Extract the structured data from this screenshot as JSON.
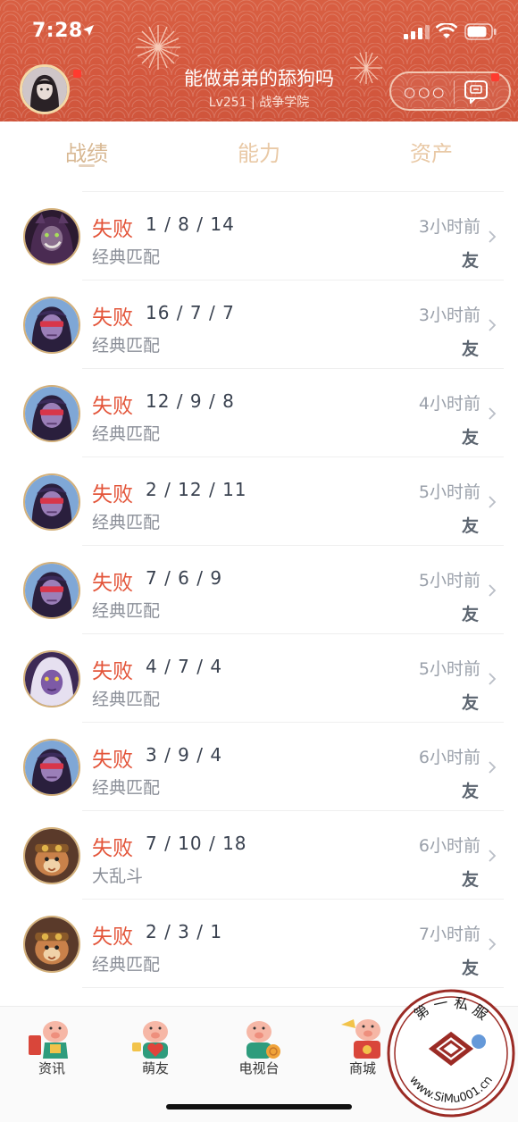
{
  "status_bar": {
    "time": "7:28"
  },
  "profile": {
    "name": "能做弟弟的舔狗吗",
    "subtitle": "Lv251 | 战争学院",
    "more_label": "○○○"
  },
  "tabs": [
    {
      "label": "战绩",
      "active": true
    },
    {
      "label": "能力",
      "active": false
    },
    {
      "label": "资产",
      "active": false
    }
  ],
  "matches": [
    {
      "result": "失败",
      "kda": "1 / 8 / 14",
      "mode": "经典匹配",
      "time": "3小时前",
      "tag": "友",
      "champion_icon": "dark-queen-portrait"
    },
    {
      "result": "失败",
      "kda": "16 / 7 / 7",
      "mode": "经典匹配",
      "time": "3小时前",
      "tag": "友",
      "champion_icon": "masked-assassin-portrait"
    },
    {
      "result": "失败",
      "kda": "12 / 9 / 8",
      "mode": "经典匹配",
      "time": "4小时前",
      "tag": "友",
      "champion_icon": "masked-assassin-portrait"
    },
    {
      "result": "失败",
      "kda": "2 / 12 / 11",
      "mode": "经典匹配",
      "time": "5小时前",
      "tag": "友 ",
      "champion_icon": "masked-assassin-portrait"
    },
    {
      "result": "失败",
      "kda": "7 / 6 / 9",
      "mode": "经典匹配",
      "time": "5小时前",
      "tag": "友",
      "champion_icon": "masked-assassin-portrait"
    },
    {
      "result": "失败",
      "kda": "4 / 7 / 4",
      "mode": "经典匹配",
      "time": "5小时前",
      "tag": "友",
      "champion_icon": "violet-sorceress-portrait"
    },
    {
      "result": "失败",
      "kda": "3 / 9 / 4",
      "mode": "经典匹配",
      "time": "6小时前",
      "tag": "友",
      "champion_icon": "masked-assassin-portrait"
    },
    {
      "result": "失败",
      "kda": "7 / 10 / 18",
      "mode": "大乱斗",
      "time": "6小时前",
      "tag": "友",
      "champion_icon": "yordle-scout-portrait"
    },
    {
      "result": "失败",
      "kda": "2 / 3 / 1",
      "mode": "经典匹配",
      "time": "7小时前",
      "tag": "友",
      "champion_icon": "yordle-scout-portrait"
    }
  ],
  "bottom_nav": [
    {
      "label": "资讯",
      "icon": "pig-newspaper-icon"
    },
    {
      "label": "萌友",
      "icon": "pig-heart-icon"
    },
    {
      "label": "电视台",
      "icon": "pig-coin-icon"
    },
    {
      "label": "商城",
      "icon": "pig-gift-icon"
    }
  ],
  "watermark": {
    "text": "第 一 私 服",
    "url": "www.SiMu001.cn"
  },
  "colors": {
    "header": "#d65a3f",
    "loss": "#e3553a",
    "tab_gold": "#e9c9a6"
  }
}
